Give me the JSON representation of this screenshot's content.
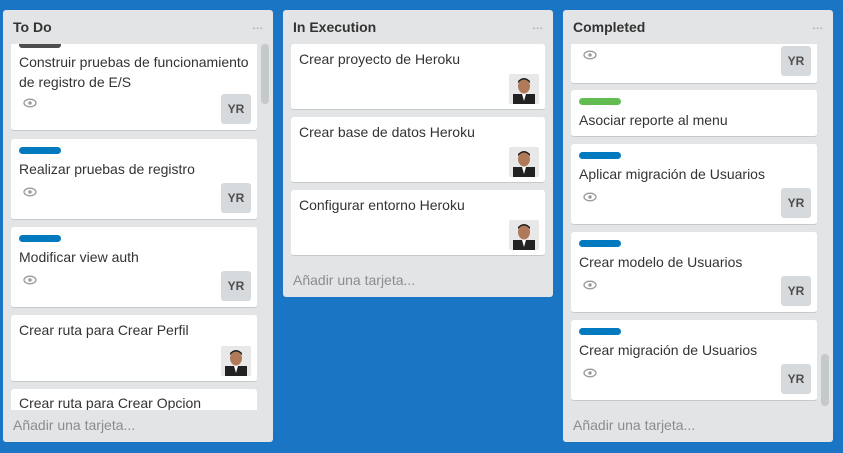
{
  "lists": [
    {
      "title": "To Do",
      "menu": "...",
      "add_card": "Añadir una tarjeta...",
      "cards": [
        {
          "title": "Construir pruebas de funcionamiento de registro de E/S",
          "member": "YR"
        },
        {
          "title": "Realizar pruebas de registro",
          "member": "YR"
        },
        {
          "title": "Modificar view auth",
          "member": "YR"
        },
        {
          "title": "Crear ruta para Crear Perfil"
        },
        {
          "title": "Crear ruta para Crear Opcion"
        }
      ]
    },
    {
      "title": "In Execution",
      "menu": "...",
      "add_card": "Añadir una tarjeta...",
      "cards": [
        {
          "title": "Crear proyecto de Heroku"
        },
        {
          "title": "Crear base de datos Heroku"
        },
        {
          "title": "Configurar entorno Heroku"
        }
      ]
    },
    {
      "title": "Completed",
      "menu": "...",
      "add_card": "Añadir una tarjeta...",
      "cards": [
        {
          "title": "",
          "member": "YR"
        },
        {
          "title": "Asociar reporte al menu"
        },
        {
          "title": "Aplicar migración de Usuarios",
          "member": "YR"
        },
        {
          "title": "Crear modelo de Usuarios",
          "member": "YR"
        },
        {
          "title": "Crear migración de Usuarios",
          "member": "YR"
        }
      ]
    }
  ],
  "colors": {
    "board_background": "#1a75c5",
    "list_background": "#e2e4e6",
    "label_blue": "#0079bf",
    "label_green": "#61bd4f",
    "label_black": "#4d4d4d"
  },
  "icons": {
    "watch": "eye-icon",
    "avatar": "user-photo-icon"
  }
}
